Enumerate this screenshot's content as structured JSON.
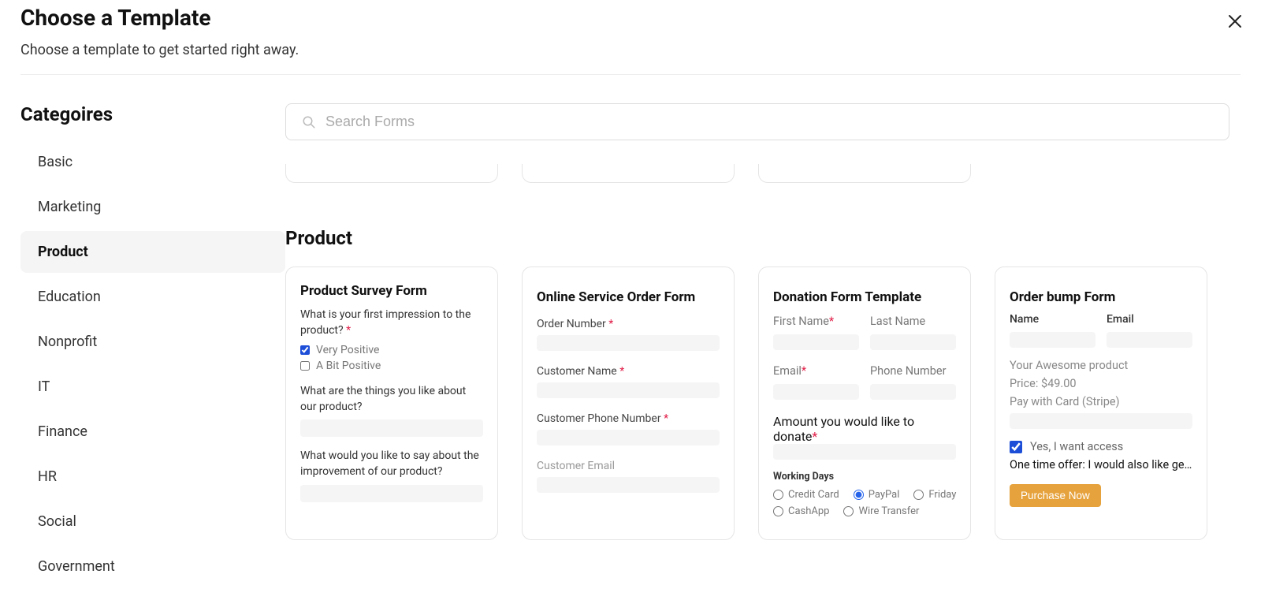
{
  "header": {
    "title": "Choose a Template",
    "subtitle": "Choose a template to get started right away."
  },
  "sidebar": {
    "title": "Categoires",
    "items": [
      {
        "label": "Basic",
        "active": false
      },
      {
        "label": "Marketing",
        "active": false
      },
      {
        "label": "Product",
        "active": true
      },
      {
        "label": "Education",
        "active": false
      },
      {
        "label": "Nonprofit",
        "active": false
      },
      {
        "label": "IT",
        "active": false
      },
      {
        "label": "Finance",
        "active": false
      },
      {
        "label": "HR",
        "active": false
      },
      {
        "label": "Social",
        "active": false
      },
      {
        "label": "Government",
        "active": false
      }
    ]
  },
  "search": {
    "placeholder": "Search Forms"
  },
  "section": {
    "title": "Product"
  },
  "card1": {
    "title": "Product Survey Form",
    "q1": "What is your first impression to the product?",
    "opt1": "Very Positive",
    "opt2": "A Bit Positive",
    "q2": "What are the things you like about our product?",
    "q3": "What would you like to say about the improvement of our product?"
  },
  "card2": {
    "title": "Online Service Order Form",
    "f1": "Order Number",
    "f2": "Customer Name",
    "f3": "Customer Phone Number",
    "f4": "Customer Email"
  },
  "card3": {
    "title": "Donation Form Template",
    "first": "First Name",
    "last": "Last Name",
    "email": "Email",
    "phone": "Phone Number",
    "amount": "Amount you would like to donate",
    "days": "Working Days",
    "r1": "Credit Card",
    "r2": "PayPal",
    "r3": "Friday",
    "r4": "CashApp",
    "r5": "Wire Transfer"
  },
  "card4": {
    "title": "Order bump Form",
    "name": "Name",
    "email": "Email",
    "p1": "Your Awesome product",
    "p2": "Price: $49.00",
    "p3": "Pay with Card (Stripe)",
    "access": "Yes, I want access",
    "offer": "One time offer: I would also like get...",
    "btn": "Purchase Now"
  }
}
